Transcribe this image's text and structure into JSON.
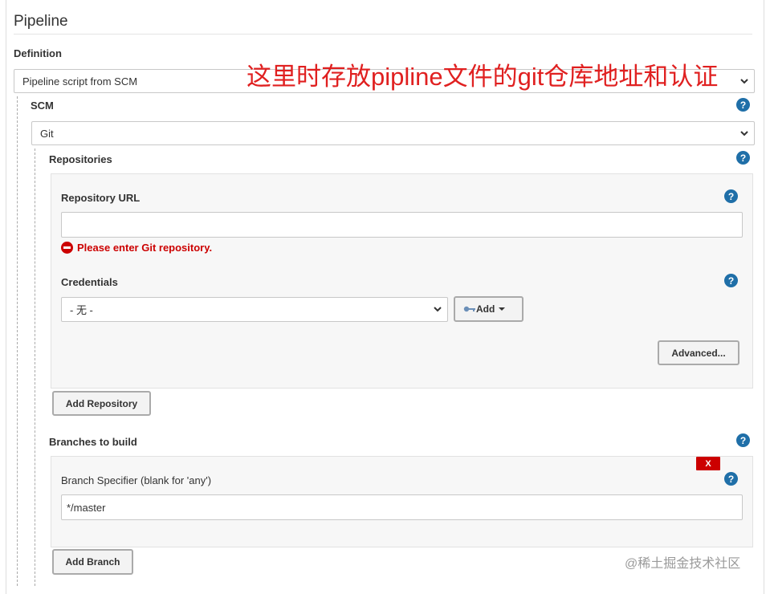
{
  "section": {
    "title": "Pipeline"
  },
  "definition": {
    "label": "Definition",
    "selected": "Pipeline script from SCM"
  },
  "annotation": "这里时存放pipline文件的git仓库地址和认证",
  "scm": {
    "label": "SCM",
    "selected": "Git"
  },
  "repositories": {
    "label": "Repositories",
    "repo_url_label": "Repository URL",
    "repo_url_value": "",
    "error": "Please enter Git repository.",
    "credentials_label": "Credentials",
    "credentials_selected": "- 无 -",
    "add_label": "Add",
    "advanced_label": "Advanced...",
    "add_repository_label": "Add Repository"
  },
  "branches": {
    "label": "Branches to build",
    "delete_label": "X",
    "specifier_label": "Branch Specifier (blank for 'any')",
    "specifier_value": "*/master",
    "add_branch_label": "Add Branch"
  },
  "help_glyph": "?",
  "watermark": "@稀土掘金技术社区",
  "colors": {
    "help": "#1f6fa8",
    "error": "#cc0000",
    "annotation": "#e02020"
  }
}
